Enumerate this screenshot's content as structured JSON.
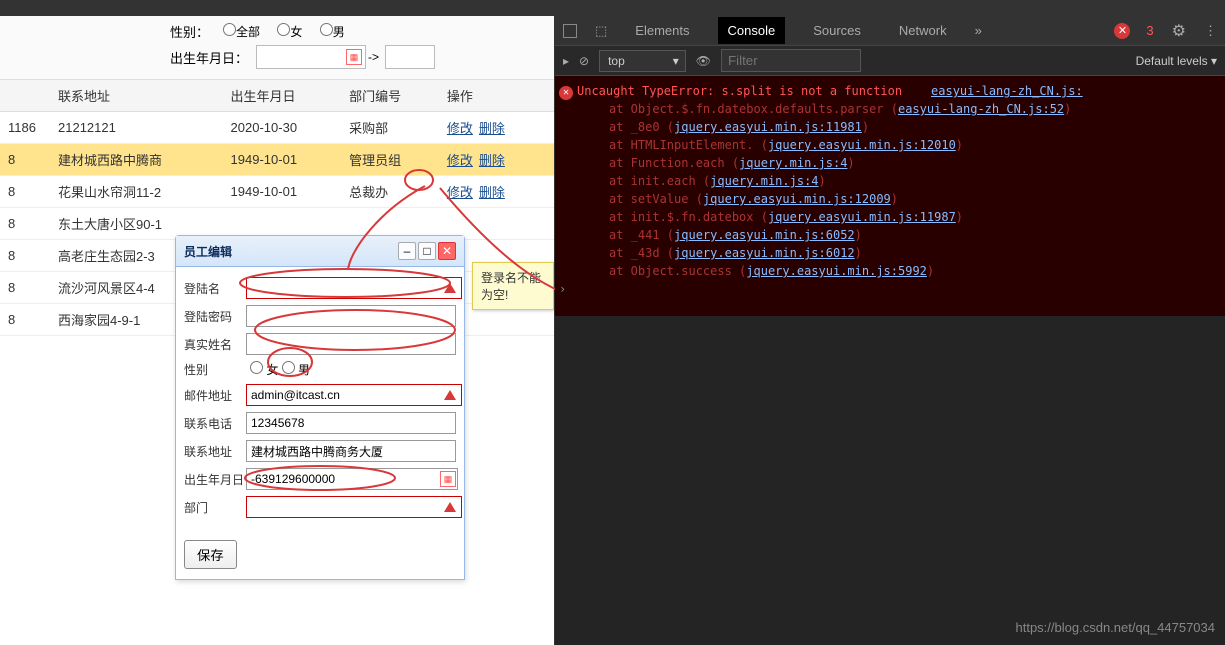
{
  "search": {
    "gender_label": "性别：",
    "gender_all": "全部",
    "gender_female": "女",
    "gender_male": "男",
    "birthday_label": "出生年月日：",
    "arrow": "->"
  },
  "table": {
    "headers": [
      "联系地址",
      "出生年月日",
      "部门编号",
      "操作"
    ],
    "rows": [
      {
        "col0": "1186",
        "addr": "21212121",
        "birth": "2020-10-30",
        "dept": "采购部",
        "edit": "修改",
        "del": "删除",
        "highlighted": false
      },
      {
        "col0": "8",
        "addr": "建材城西路中腾商",
        "birth": "1949-10-01",
        "dept": "管理员组",
        "edit": "修改",
        "del": "删除",
        "highlighted": true
      },
      {
        "col0": "8",
        "addr": "花果山水帘洞11-2",
        "birth": "1949-10-01",
        "dept": "总裁办",
        "edit": "修改",
        "del": "删除",
        "highlighted": false
      },
      {
        "col0": "8",
        "addr": "东土大唐小区90-1",
        "birth": "",
        "dept": "",
        "edit": "",
        "del": "",
        "highlighted": false
      },
      {
        "col0": "8",
        "addr": "高老庄生态园2-3",
        "birth": "",
        "dept": "",
        "edit": "",
        "del": "",
        "highlighted": false
      },
      {
        "col0": "8",
        "addr": "流沙河风景区4-4",
        "birth": "",
        "dept": "",
        "edit": "",
        "del": "",
        "highlighted": false
      },
      {
        "col0": "8",
        "addr": "西海家园4-9-1",
        "birth": "",
        "dept": "",
        "edit": "",
        "del": "",
        "highlighted": false
      }
    ]
  },
  "dialog": {
    "title": "员工编辑",
    "loginName": "登陆名",
    "loginPwd": "登陆密码",
    "realName": "真实姓名",
    "gender": "性别",
    "gender_f": "女",
    "gender_m": "男",
    "email": "邮件地址",
    "email_val": "admin@itcast.cn",
    "phone": "联系电话",
    "phone_val": "12345678",
    "address": "联系地址",
    "address_val": "建材城西路中腾商务大厦",
    "birthday": "出生年月日",
    "birthday_val": "-639129600000",
    "deptLabel": "部门",
    "save": "保存"
  },
  "tooltip": {
    "text": "登录名不能为空!"
  },
  "devtools": {
    "tabs": {
      "elements": "Elements",
      "console": "Console",
      "sources": "Sources",
      "network": "Network"
    },
    "error_count": "3",
    "context": "top",
    "filter_placeholder": "Filter",
    "levels": "Default levels ▾",
    "error_main": "Uncaught TypeError: s.split is not a function",
    "error_main_file": "easyui-lang-zh_CN.js:",
    "lines": [
      {
        "text": "at Object.$.fn.datebox.defaults.parser (",
        "file": "easyui-lang-zh_CN.js:52",
        "close": ")"
      },
      {
        "text": "at _8e0 (",
        "file": "jquery.easyui.min.js:11981",
        "close": ")"
      },
      {
        "text": "at HTMLInputElement.<anonymous> (",
        "file": "jquery.easyui.min.js:12010",
        "close": ")"
      },
      {
        "text": "at Function.each (",
        "file": "jquery.min.js:4",
        "close": ")"
      },
      {
        "text": "at init.each (",
        "file": "jquery.min.js:4",
        "close": ")"
      },
      {
        "text": "at setValue (",
        "file": "jquery.easyui.min.js:12009",
        "close": ")"
      },
      {
        "text": "at init.$.fn.datebox (",
        "file": "jquery.easyui.min.js:11987",
        "close": ")"
      },
      {
        "text": "at _441 (",
        "file": "jquery.easyui.min.js:6052",
        "close": ")"
      },
      {
        "text": "at _43d (",
        "file": "jquery.easyui.min.js:6012",
        "close": ")"
      },
      {
        "text": "at Object.success (",
        "file": "jquery.easyui.min.js:5992",
        "close": ")"
      }
    ]
  },
  "watermark": "https://blog.csdn.net/qq_44757034"
}
